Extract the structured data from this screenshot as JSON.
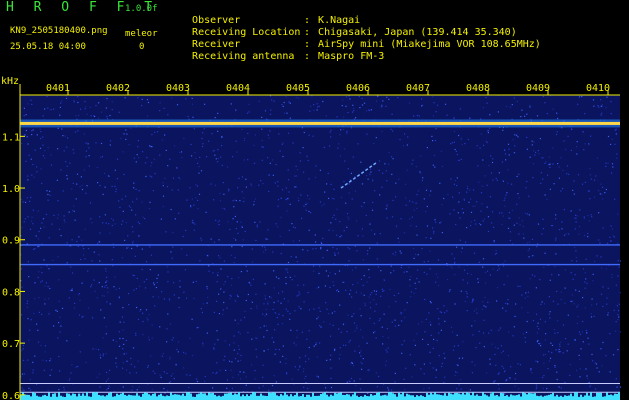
{
  "header": {
    "brand": "H R O F F T",
    "version": "1.0.0f",
    "filename": "KN9_2505180400.png",
    "label": "meleor",
    "datetime": "25.05.18 04:00",
    "count": "0",
    "meta": [
      {
        "key": "Observer",
        "value": "K.Nagai"
      },
      {
        "key": "Receiving Location",
        "value": "Chigasaki, Japan (139.414 35.340)"
      },
      {
        "key": "Receiver",
        "value": "AirSpy mini (Miakejima VOR 108.65MHz)"
      },
      {
        "key": "Receiving antenna",
        "value": "Maspro FM-3"
      }
    ]
  },
  "colors": {
    "background": "#000000",
    "label_text": "#f3f000",
    "title_text": "#39e639",
    "spectrum_noise": "#1a2fb0",
    "carrier": "#ffd84a",
    "baseline": "#3fe0ff"
  },
  "chart_data": {
    "type": "heatmap",
    "title": "",
    "ylabel": "kHz",
    "x_ticks": [
      "0401",
      "0402",
      "0403",
      "0404",
      "0405",
      "0406",
      "0407",
      "0408",
      "0409",
      "0410"
    ],
    "y_ticks": [
      1.1,
      1.0,
      0.9,
      0.8,
      0.7,
      0.6
    ],
    "ylim": [
      0.59,
      1.18
    ],
    "signals": [
      {
        "name": "carrier",
        "freq_khz": 1.125
      },
      {
        "name": "line-1",
        "freq_khz": 0.89
      },
      {
        "name": "line-2",
        "freq_khz": 0.852
      },
      {
        "name": "line-3",
        "freq_khz": 0.622
      },
      {
        "name": "line-4",
        "freq_khz": 0.605
      }
    ],
    "meteor_echo": {
      "x_minutes": [
        5.6,
        6.2
      ],
      "freq_khz": [
        1.0,
        1.05
      ]
    }
  }
}
